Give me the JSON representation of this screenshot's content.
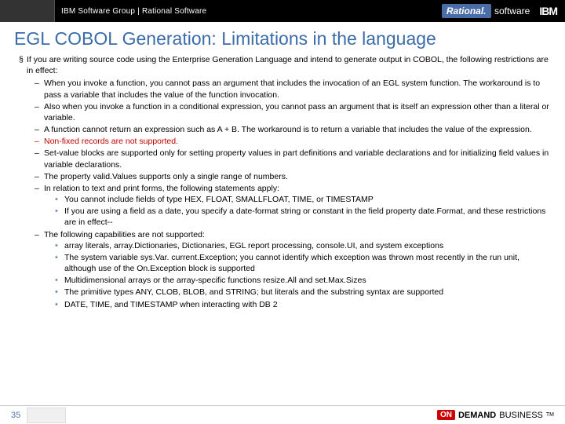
{
  "header": {
    "group_text": "IBM Software Group | Rational Software",
    "rational_label": "Rational.",
    "software_label": "software",
    "ibm_label": "IBM"
  },
  "title": "EGL COBOL Generation: Limitations in the language",
  "intro": {
    "bullet": "§",
    "text": "If you are writing source code using the Enterprise Generation Language and intend to generate output in COBOL, the following restrictions are in effect:"
  },
  "items": [
    {
      "text": "When you invoke a function, you cannot pass an argument that includes the invocation of an EGL system function. The workaround is to pass a variable that includes the value of the function invocation."
    },
    {
      "text": "Also when you invoke a function in a conditional expression, you cannot pass an argument that is itself an expression other than a literal or variable."
    },
    {
      "text": "A function cannot return an expression such as A + B. The workaround is to return a variable that includes the value of the expression."
    },
    {
      "text": "Non-fixed records are not supported.",
      "red": true
    },
    {
      "text": "Set-value blocks are supported only for setting property values in part definitions and variable declarations and for initializing field values in variable declarations."
    },
    {
      "text": "The property valid.Values supports only a single range of numbers."
    },
    {
      "text": "In relation to text and print forms, the following statements apply:",
      "sub": [
        "You cannot include fields of type HEX, FLOAT, SMALLFLOAT, TIME, or TIMESTAMP",
        "If you are using a field as a date, you specify a date-format string or constant in the field property date.Format, and these restrictions are in effect--"
      ]
    },
    {
      "text": "The following capabilities are not supported:",
      "sub": [
        "array literals, array.Dictionaries, Dictionaries, EGL report processing, console.UI, and system exceptions",
        "The system variable sys.Var. current.Exception; you cannot identify which exception was thrown most recently in the run unit, although use of the On.Exception block is supported",
        "Multidimensional arrays or the array-specific functions resize.All and set.Max.Sizes",
        "The primitive types ANY, CLOB, BLOB, and STRING; but literals and the substring syntax are supported",
        "DATE, TIME, and TIMESTAMP when interacting with DB 2"
      ]
    }
  ],
  "footer": {
    "page": "35",
    "on": "ON",
    "demand": "DEMAND",
    "business": "BUSINESS",
    "tm": "TM"
  }
}
